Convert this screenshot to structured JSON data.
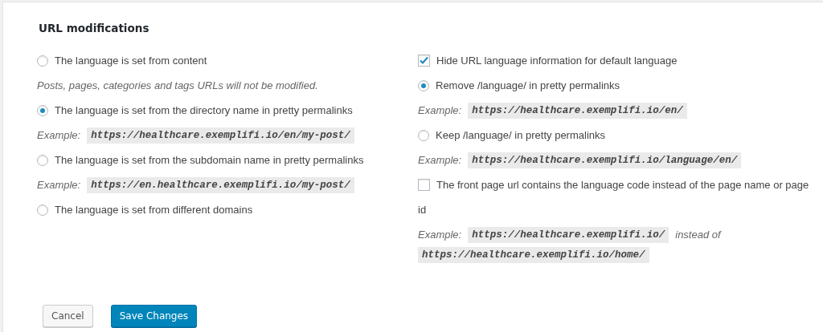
{
  "title": "URL modifications",
  "left": [
    {
      "kind": "radio",
      "label": "The language is set from content",
      "selected": false
    },
    {
      "kind": "note",
      "text": "Posts, pages, categories and tags URLs will not be modified."
    },
    {
      "kind": "radio",
      "label": "The language is set from the directory name in pretty permalinks",
      "selected": true
    },
    {
      "kind": "example",
      "label": "Example:",
      "code": "https://healthcare.exemplifi.io/en/my-post/"
    },
    {
      "kind": "radio",
      "label": "The language is set from the subdomain name in pretty permalinks",
      "selected": false
    },
    {
      "kind": "example",
      "label": "Example:",
      "code": "https://en.healthcare.exemplifi.io/my-post/"
    },
    {
      "kind": "radio",
      "label": "The language is set from different domains",
      "selected": false
    }
  ],
  "right": [
    {
      "kind": "checkbox",
      "label": "Hide URL language information for default language",
      "checked": true
    },
    {
      "kind": "radio",
      "label": "Remove /language/ in pretty permalinks",
      "selected": true
    },
    {
      "kind": "example",
      "label": "Example:",
      "code": "https://healthcare.exemplifi.io/en/"
    },
    {
      "kind": "radio",
      "label": "Keep /language/ in pretty permalinks",
      "selected": false
    },
    {
      "kind": "example",
      "label": "Example:",
      "code": "https://healthcare.exemplifi.io/language/en/"
    },
    {
      "kind": "checkbox",
      "label": "The front page url contains the language code instead of the page name or page",
      "checked": false
    },
    {
      "kind": "text",
      "text": "id"
    },
    {
      "kind": "example",
      "label": "Example:",
      "code": "https://healthcare.exemplifi.io/",
      "suffix": "instead of",
      "code2": "https://healthcare.exemplifi.io/home/"
    }
  ],
  "buttons": [
    {
      "kind": "secondary",
      "label": "Cancel"
    },
    {
      "kind": "primary",
      "label": "Save Changes"
    }
  ]
}
